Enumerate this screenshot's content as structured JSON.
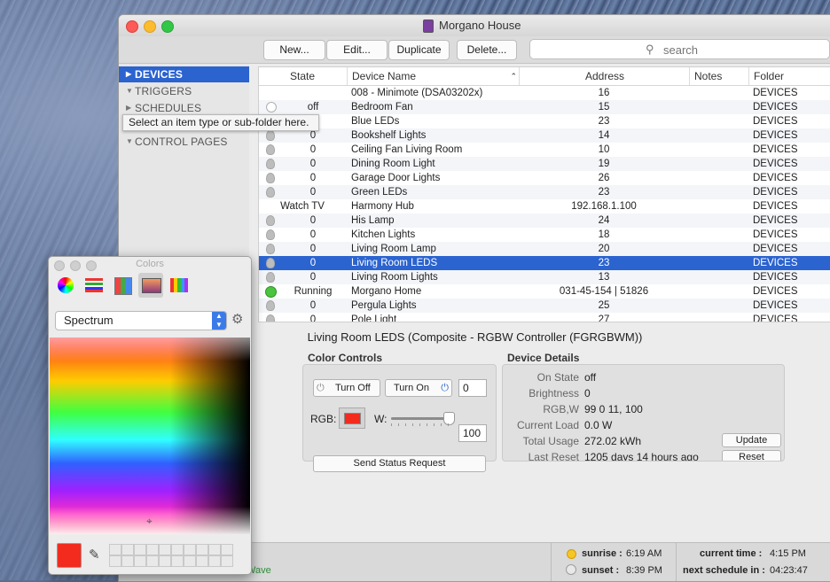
{
  "window": {
    "title": "Morgano House"
  },
  "toolbar": {
    "new_label": "New...",
    "edit_label": "Edit...",
    "duplicate_label": "Duplicate",
    "delete_label": "Delete...",
    "search_placeholder": "search"
  },
  "sidebar": {
    "items": [
      {
        "label": "DEVICES"
      },
      {
        "label": "TRIGGERS"
      },
      {
        "label": "SCHEDULES"
      },
      {
        "label": "CONTROL PAGES"
      }
    ],
    "tooltip": "Select an item type or sub-folder here."
  },
  "table": {
    "headers": {
      "state": "State",
      "name": "Device Name",
      "address": "Address",
      "notes": "Notes",
      "folder": "Folder"
    },
    "rows": [
      {
        "state": "",
        "name": "008 - Minimote (DSA03202x)",
        "address": "16",
        "folder": "DEVICES",
        "icon": "none"
      },
      {
        "state": "off",
        "name": "Bedroom Fan",
        "address": "15",
        "folder": "DEVICES",
        "icon": "power"
      },
      {
        "state": "0",
        "name": "Blue LEDs",
        "address": "23",
        "folder": "DEVICES",
        "icon": "bulb"
      },
      {
        "state": "0",
        "name": "Bookshelf Lights",
        "address": "14",
        "folder": "DEVICES",
        "icon": "bulb"
      },
      {
        "state": "0",
        "name": "Ceiling Fan Living Room",
        "address": "10",
        "folder": "DEVICES",
        "icon": "bulb"
      },
      {
        "state": "0",
        "name": "Dining Room Light",
        "address": "19",
        "folder": "DEVICES",
        "icon": "bulb"
      },
      {
        "state": "0",
        "name": "Garage Door Lights",
        "address": "26",
        "folder": "DEVICES",
        "icon": "bulb"
      },
      {
        "state": "0",
        "name": "Green LEDs",
        "address": "23",
        "folder": "DEVICES",
        "icon": "bulb"
      },
      {
        "state": "Watch TV",
        "name": "Harmony Hub",
        "address": "192.168.1.100",
        "folder": "DEVICES",
        "icon": "none"
      },
      {
        "state": "0",
        "name": "His Lamp",
        "address": "24",
        "folder": "DEVICES",
        "icon": "bulb"
      },
      {
        "state": "0",
        "name": "Kitchen Lights",
        "address": "18",
        "folder": "DEVICES",
        "icon": "bulb"
      },
      {
        "state": "0",
        "name": "Living Room Lamp",
        "address": "20",
        "folder": "DEVICES",
        "icon": "bulb"
      },
      {
        "state": "0",
        "name": "Living Room LEDS",
        "address": "23",
        "folder": "DEVICES",
        "icon": "bulb"
      },
      {
        "state": "0",
        "name": "Living Room Lights",
        "address": "13",
        "folder": "DEVICES",
        "icon": "bulb"
      },
      {
        "state": "Running",
        "name": "Morgano Home",
        "address": "031-45-154 | 51826",
        "folder": "DEVICES",
        "icon": "green"
      },
      {
        "state": "0",
        "name": "Pergula Lights",
        "address": "25",
        "folder": "DEVICES",
        "icon": "bulb"
      },
      {
        "state": "0",
        "name": "Pole Light",
        "address": "27",
        "folder": "DEVICES",
        "icon": "bulb"
      }
    ]
  },
  "detail": {
    "title": "Living Room LEDS (Composite - RGBW Controller (FGRGBWM))",
    "color_controls": {
      "title": "Color Controls",
      "turn_off": "Turn Off",
      "turn_on": "Turn On",
      "brightness_value": "0",
      "rgb_label": "RGB:",
      "rgb_color": "#f32a1e",
      "w_label": "W:",
      "w_value": "100",
      "w_level_percent": 100,
      "send_status": "Send Status Request"
    },
    "device_details": {
      "title": "Device Details",
      "fields": [
        {
          "label": "On State",
          "value": "off"
        },
        {
          "label": "Brightness",
          "value": "0"
        },
        {
          "label": "RGB,W",
          "value": "99 0 11, 100"
        },
        {
          "label": "Current Load",
          "value": "0.0 W"
        },
        {
          "label": "Total Usage",
          "value": "272.02 kWh"
        },
        {
          "label": "Last Reset",
          "value": "1205 days 14 hours ago"
        }
      ],
      "update_label": "Update",
      "reset_label": "Reset"
    }
  },
  "statusbar": {
    "left_text": "Wave",
    "sunrise_label": "sunrise :",
    "sunrise_value": "6:19 AM",
    "sunset_label": "sunset :",
    "sunset_value": "8:39 PM",
    "current_time_label": "current time :",
    "current_time_value": "4:15 PM",
    "next_schedule_label": "next schedule in :",
    "next_schedule_value": "04:23:47"
  },
  "colors_panel": {
    "title": "Colors",
    "mode": "Spectrum",
    "current_color": "#f32a1e"
  },
  "colors": {
    "accent": "#2b63cf",
    "running": "#4bc43f"
  }
}
